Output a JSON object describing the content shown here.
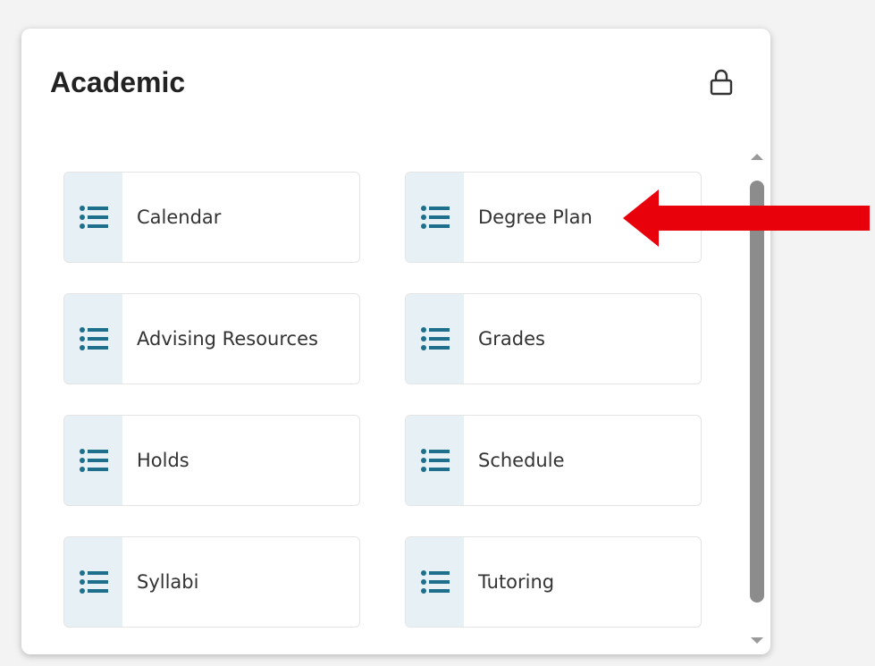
{
  "panel": {
    "title": "Academic",
    "lock_icon": "lock-icon"
  },
  "tiles": [
    {
      "label": "Calendar",
      "icon": "list-icon"
    },
    {
      "label": "Degree Plan",
      "icon": "list-icon"
    },
    {
      "label": "Advising Resources",
      "icon": "list-icon"
    },
    {
      "label": "Grades",
      "icon": "list-icon"
    },
    {
      "label": "Holds",
      "icon": "list-icon"
    },
    {
      "label": "Schedule",
      "icon": "list-icon"
    },
    {
      "label": "Syllabi",
      "icon": "list-icon"
    },
    {
      "label": "Tutoring",
      "icon": "list-icon"
    }
  ],
  "colors": {
    "icon_accent": "#1e6f8c",
    "icon_bg": "#e7f0f5",
    "annotation_arrow": "#e8000b"
  }
}
